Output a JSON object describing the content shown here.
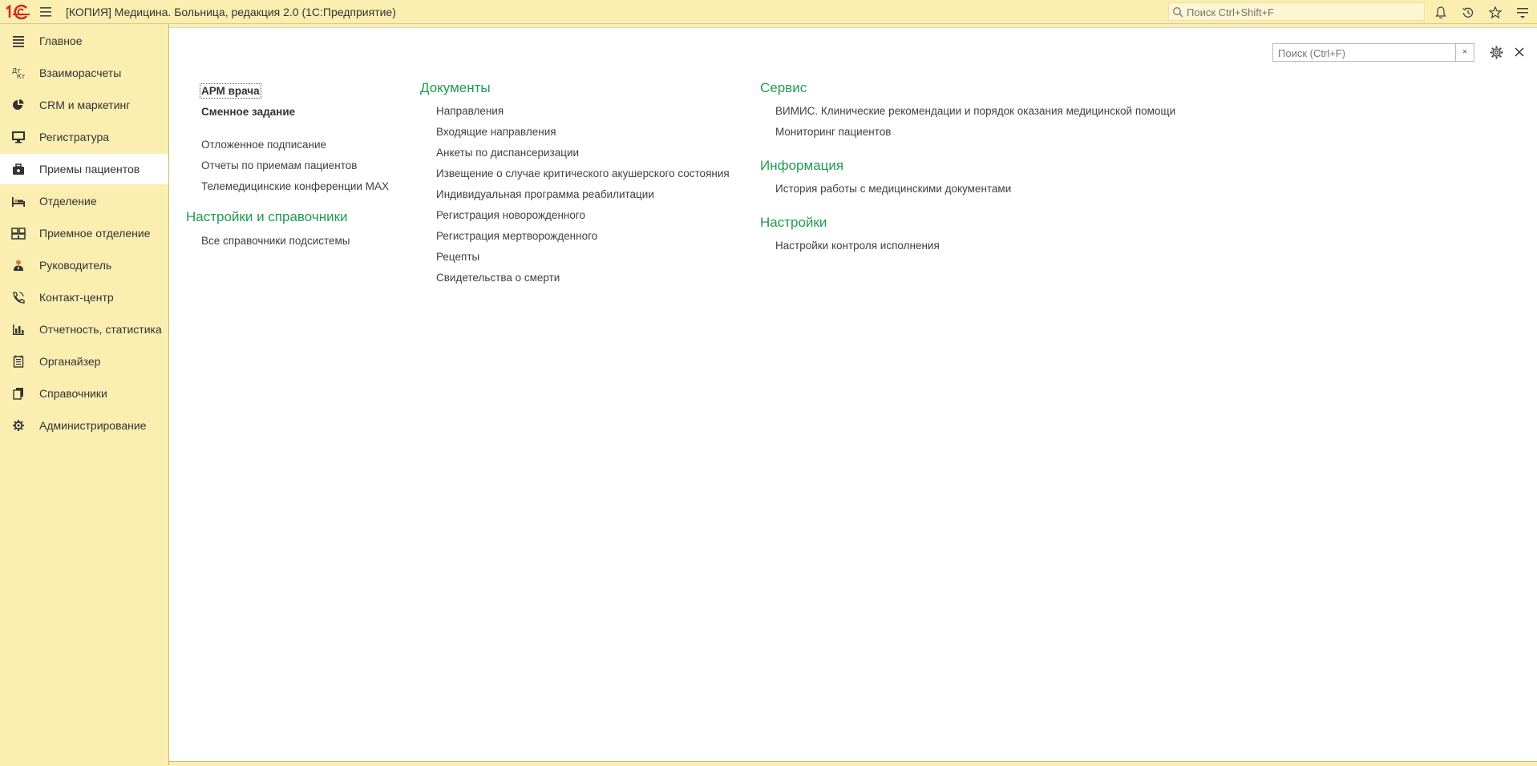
{
  "app": {
    "logo_text": "1С",
    "title": "[КОПИЯ] Медицина. Больница, редакция 2.0  (1С:Предприятие)",
    "global_search_placeholder": "Поиск Ctrl+Shift+F",
    "top_icons": [
      "burger-menu-icon",
      "magnifier-icon",
      "bell-icon",
      "history-icon",
      "star-icon",
      "settings-menu-icon"
    ]
  },
  "sidebar": {
    "items": [
      {
        "label": "Главное",
        "icon": "list-icon",
        "active": false
      },
      {
        "label": "Взаиморасчеты",
        "icon": "settlements-icon",
        "active": false
      },
      {
        "label": "CRM и маркетинг",
        "icon": "pie-chart-icon",
        "active": false
      },
      {
        "label": "Регистратура",
        "icon": "monitor-icon",
        "active": false
      },
      {
        "label": "Приемы пациентов",
        "icon": "briefcase-icon",
        "active": true
      },
      {
        "label": "Отделение",
        "icon": "bed-icon",
        "active": false
      },
      {
        "label": "Приемное отделение",
        "icon": "building-icon",
        "active": false
      },
      {
        "label": "Руководитель",
        "icon": "manager-icon",
        "active": false
      },
      {
        "label": "Контакт-центр",
        "icon": "phone-icon",
        "active": false
      },
      {
        "label": "Отчетность, статистика",
        "icon": "bar-chart-icon",
        "active": false
      },
      {
        "label": "Органайзер",
        "icon": "notepad-icon",
        "active": false
      },
      {
        "label": "Справочники",
        "icon": "books-icon",
        "active": false
      },
      {
        "label": "Администрирование",
        "icon": "gear-icon",
        "active": false
      }
    ]
  },
  "main": {
    "search_placeholder": "Поиск (Ctrl+F)",
    "clear_label": "×",
    "column1": {
      "top_commands": [
        "АРМ врача",
        "Сменное задание"
      ],
      "commands": [
        "Отложенное подписание",
        "Отчеты по приемам пациентов",
        "Телемедицинские конференции MAX"
      ],
      "section_settings_title": "Настройки и справочники",
      "settings_commands": [
        "Все справочники подсистемы"
      ]
    },
    "column2": {
      "title": "Документы",
      "commands": [
        "Направления",
        "Входящие направления",
        "Анкеты по диспансеризации",
        "Извещение о случае критического акушерского состояния",
        "Индивидуальная программа реабилитации",
        "Регистрация новорожденного",
        "Регистрация мертворожденного",
        "Рецепты",
        "Свидетельства о смерти"
      ]
    },
    "column3": {
      "service_title": "Сервис",
      "service_commands": [
        "ВИМИС. Клинические рекомендации и порядок оказания медицинской помощи",
        "Мониторинг пациентов"
      ],
      "info_title": "Информация",
      "info_commands": [
        "История работы с медицинскими документами"
      ],
      "settings_title": "Настройки",
      "settings_commands": [
        "Настройки контроля исполнения"
      ]
    }
  },
  "colors": {
    "panel_bg": "#fbeeb1",
    "section_title": "#1f9c4f",
    "logo": "#d52b1e"
  }
}
